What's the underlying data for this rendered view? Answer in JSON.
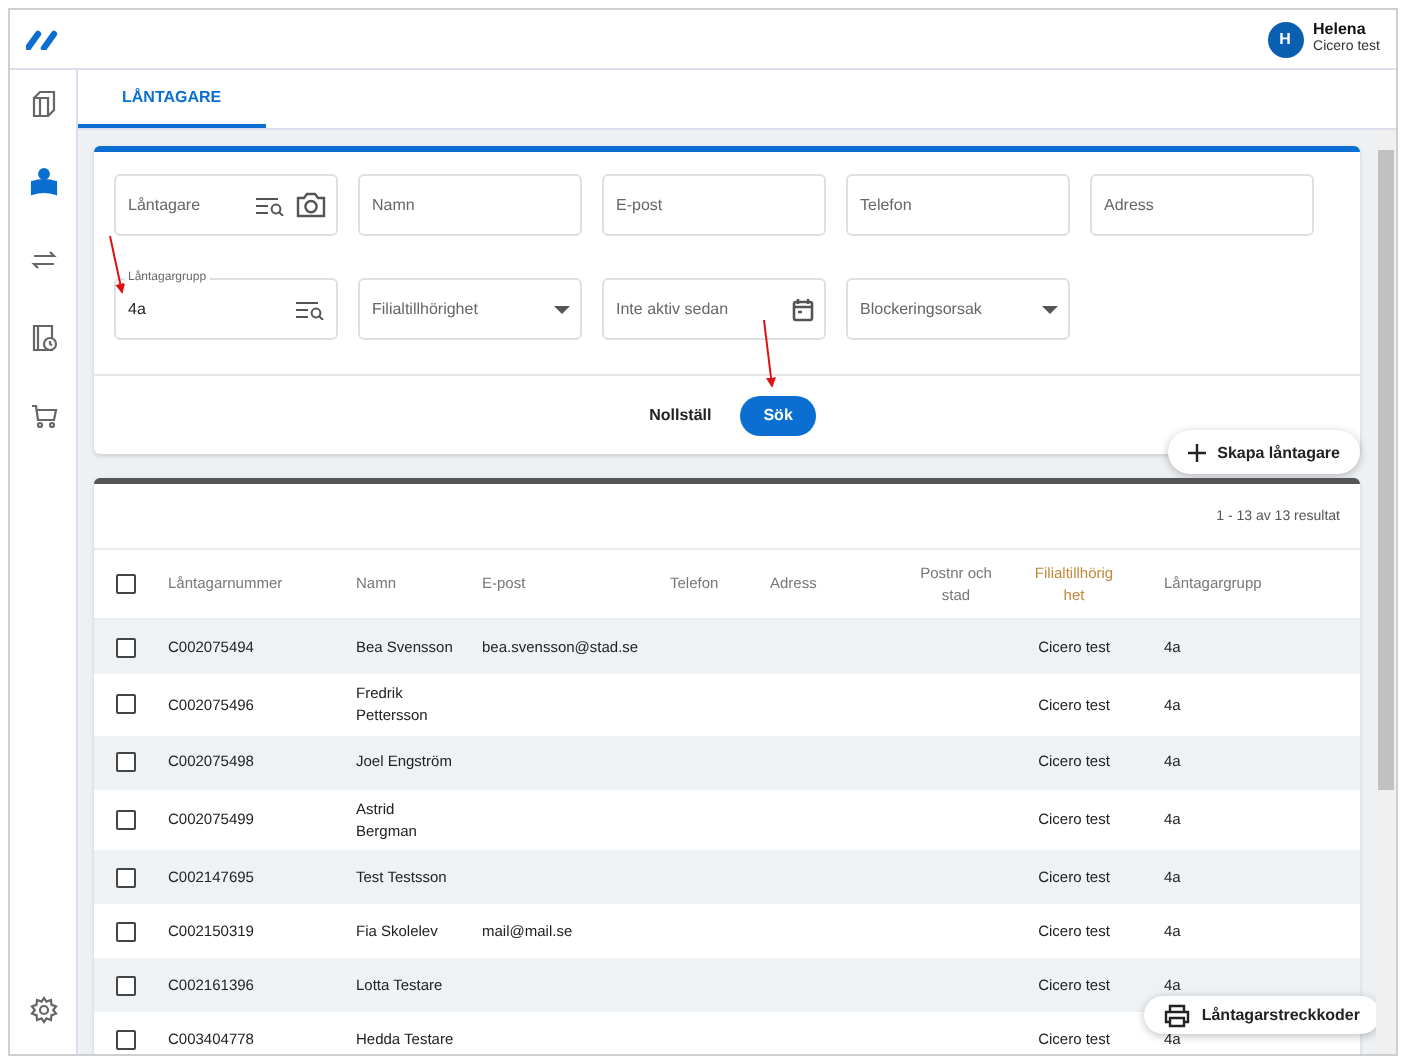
{
  "header": {
    "user_initial": "H",
    "user_name": "Helena",
    "user_org": "Cicero test"
  },
  "sidebar": {
    "items": [
      {
        "kind": "books",
        "selected": false
      },
      {
        "kind": "reader",
        "selected": true
      },
      {
        "kind": "transfer",
        "selected": false
      },
      {
        "kind": "book-clock",
        "selected": false
      },
      {
        "kind": "cart",
        "selected": false
      }
    ],
    "bottom": [
      {
        "kind": "settings",
        "selected": false
      }
    ]
  },
  "tabs": [
    {
      "label": "LÅNTAGARE",
      "selected": true
    }
  ],
  "search": {
    "fields": [
      {
        "kind": "lookup-camera",
        "placeholder": "Låntagare"
      },
      {
        "kind": "text",
        "placeholder": "Namn"
      },
      {
        "kind": "text",
        "placeholder": "E-post"
      },
      {
        "kind": "text",
        "placeholder": "Telefon"
      },
      {
        "kind": "text",
        "placeholder": "Adress"
      },
      {
        "kind": "lookup",
        "label": "Låntagargrupp",
        "value": "4a"
      },
      {
        "kind": "select",
        "placeholder": "Filialtillhörighet"
      },
      {
        "kind": "date",
        "placeholder": "Inte aktiv sedan"
      },
      {
        "kind": "select",
        "placeholder": "Blockeringsorsak"
      }
    ],
    "reset_button": "Nollställ",
    "search_button": "Sök",
    "create_button": "Skapa låntagare"
  },
  "results": {
    "count": "1 - 13 av 13 resultat",
    "all_checked": false,
    "columns": [
      "Låntagarnummer",
      "Namn",
      "E-post",
      "Telefon",
      "Adress",
      "Postnr och stad",
      "Filialtillhörighet",
      "Låntagargrupp"
    ],
    "rows": [
      {
        "checked": false,
        "cells": [
          "C002075494",
          "Bea Svensson",
          "bea.svensson@stad.se",
          "",
          "",
          "",
          "Cicero test",
          "4a"
        ]
      },
      {
        "checked": false,
        "cells": [
          "C002075496",
          "Fredrik Pettersson",
          "",
          "",
          "",
          "",
          "Cicero test",
          "4a"
        ]
      },
      {
        "checked": false,
        "cells": [
          "C002075498",
          "Joel Engström",
          "",
          "",
          "",
          "",
          "Cicero test",
          "4a"
        ]
      },
      {
        "checked": false,
        "cells": [
          "C002075499",
          "Astrid Bergman",
          "",
          "",
          "",
          "",
          "Cicero test",
          "4a"
        ]
      },
      {
        "checked": false,
        "cells": [
          "C002147695",
          "Test Testsson",
          "",
          "",
          "",
          "",
          "Cicero test",
          "4a"
        ]
      },
      {
        "checked": false,
        "cells": [
          "C002150319",
          "Fia Skolelev",
          "mail@mail.se",
          "",
          "",
          "",
          "Cicero test",
          "4a"
        ]
      },
      {
        "checked": false,
        "cells": [
          "C002161396",
          "Lotta Testare",
          "",
          "",
          "",
          "",
          "Cicero test",
          "4a"
        ]
      },
      {
        "checked": false,
        "cells": [
          "C003404778",
          "Hedda Testare",
          "",
          "",
          "",
          "",
          "Cicero test",
          "4a"
        ]
      }
    ]
  },
  "print_button": "Låntagarstreckkoder"
}
